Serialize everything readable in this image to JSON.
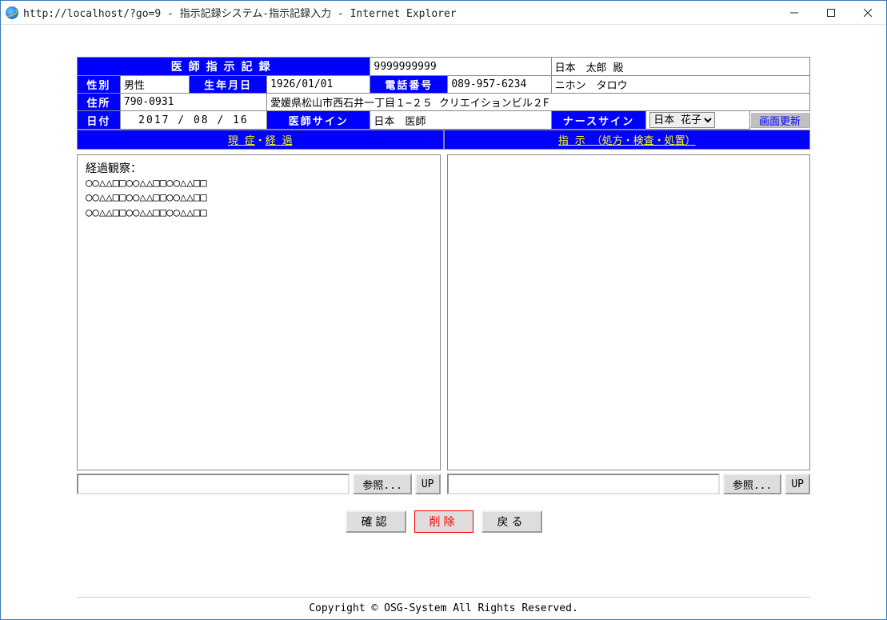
{
  "window": {
    "title": "http://localhost/?go=9 - 指示記録システム-指示記録入力 - Internet Explorer"
  },
  "header": {
    "record_title": "医師指示記録",
    "patient_id": "9999999999",
    "patient_name": "日本　太郎 殿",
    "gender_label": "性別",
    "gender": "男性",
    "dob_label": "生年月日",
    "dob": "1926/01/01",
    "phone_label": "電話番号",
    "phone": "089-957-6234",
    "patient_kana": "ニホン　タロウ",
    "address_label": "住所",
    "postal_code": "790-0931",
    "address": "愛媛県松山市西石井一丁目１−２５ クリエイションビル２F",
    "date_label": "日付",
    "date": "2017  /  08  /  16",
    "doctor_sign_label": "医師サイン",
    "doctor_sign": "日本　医師",
    "nurse_sign_label": "ナースサイン",
    "nurse_sign": "日本 花子",
    "refresh_button": "画面更新"
  },
  "sections": {
    "left": {
      "link1": "現 症",
      "sep": "・",
      "link2": "経 過"
    },
    "right": {
      "link1": "指 示",
      "paren": "（処方・検査・処置）"
    }
  },
  "left_panel": {
    "content": "経過観察：\n○○△△□□○○△△□□○○△△□□\n○○△△□□○○△△□□○○△△□□\n○○△△□□○○△△□□○○△△□□",
    "browse_label": "参照...",
    "up_label": "UP"
  },
  "right_panel": {
    "content": "",
    "browse_label": "参照...",
    "up_label": "UP"
  },
  "actions": {
    "confirm": "確認",
    "delete": "削除",
    "back": "戻る"
  },
  "footer": "Copyright © OSG-System All Rights Reserved."
}
